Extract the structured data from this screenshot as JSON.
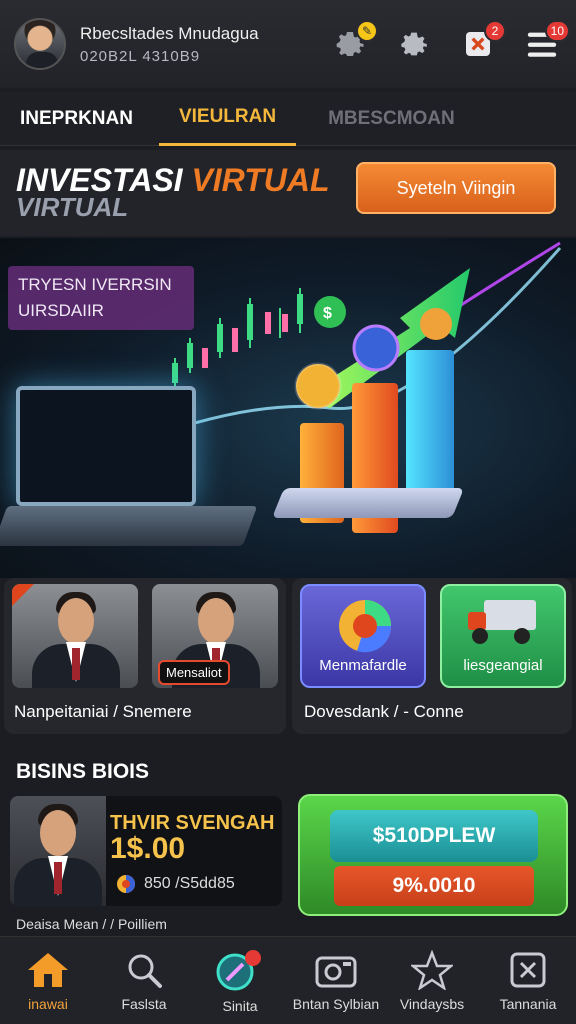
{
  "header": {
    "user_name": "Rbecsltades Mnudagua",
    "user_sub": "020B2L 4310B9",
    "badges": {
      "settings": "",
      "tasks": "2",
      "menu": "10"
    }
  },
  "tabs": [
    "INEPRKNAN",
    "VIEULRAN",
    "MBESCMOAN"
  ],
  "banner": {
    "title_a": "INVESTASI",
    "title_b": "VIRTUAL",
    "subtitle": "VIRTUAL",
    "button": "Syeteln Viingin"
  },
  "hero": {
    "label_line1": "TRYESN IVERRSIN",
    "label_line2": "UIRSDAIIR"
  },
  "cards": {
    "left_tag": "Mensaliot",
    "left_caption": "Nanpeitaniai / Snemere",
    "tile1": "Menmafardle",
    "tile2": "liesgeangial",
    "right_caption": "Dovesdank / - Conne"
  },
  "bisnis": {
    "title": "BISINS BIOIS",
    "promo_title": "THVIR SVENGAH",
    "promo_value": "1$.00",
    "promo_sub": "850 /S5dd85",
    "promo_caption": "Deaisa Mean / / Poilliem",
    "btn1": "$510DPLEW",
    "btn2": "9%.0010"
  },
  "nav": [
    {
      "label": "inawai",
      "icon": "home-icon"
    },
    {
      "label": "Faslsta",
      "icon": "search-icon"
    },
    {
      "label": "Sinita",
      "icon": "magnifier-badge-icon"
    },
    {
      "label": "Bntan Sylbian",
      "icon": "camera-icon"
    },
    {
      "label": "Vindaysbs",
      "icon": "star-icon"
    },
    {
      "label": "Tannania",
      "icon": "close-box-icon"
    }
  ],
  "colors": {
    "accent": "#f3b73c",
    "orange": "#f07b25",
    "bg": "#1c1d22"
  }
}
